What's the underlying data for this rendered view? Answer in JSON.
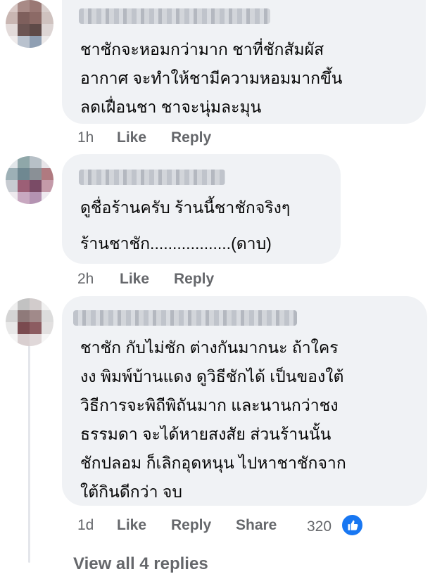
{
  "comments": [
    {
      "lines": [
        "ชาชักจะหอมกว่ามาก ชาที่ชักสัมผัส",
        "อากาศ จะทำให้ชามีความหอมมากขึ้น",
        "ลดเฝื่อนชา ชาจะนุ่มละมุน"
      ],
      "time": "1h",
      "like_label": "Like",
      "reply_label": "Reply"
    },
    {
      "lines": [
        "ดูชื่อร้านครับ ร้านนี้ชาชักจริงๆ",
        "ร้านชาชัก..................(ดาบ)"
      ],
      "time": "2h",
      "like_label": "Like",
      "reply_label": "Reply"
    },
    {
      "lines": [
        "ชาชัก กับไม่ชัก ต่างกันมากนะ ถ้าใคร",
        "งง พิมพ์บ้านแดง ดูวิธีชักได้ เป็นของใต้",
        "วิธีการจะพิถีพิถันมาก และนานกว่าชง",
        "ธรรมดา จะได้หายสงสัย ส่วนร้านนั้น",
        "ชักปลอม ก็เลิกอุดหนุน ไปหาชาชักจาก",
        "ใต้กินดีกว่า จบ"
      ],
      "time": "1d",
      "like_label": "Like",
      "reply_label": "Reply",
      "share_label": "Share",
      "reaction_count": "320",
      "reaction_icon": "thumbs-up-icon",
      "reaction_color": "#1877f2"
    }
  ],
  "view_more_label": "View all 4 replies"
}
